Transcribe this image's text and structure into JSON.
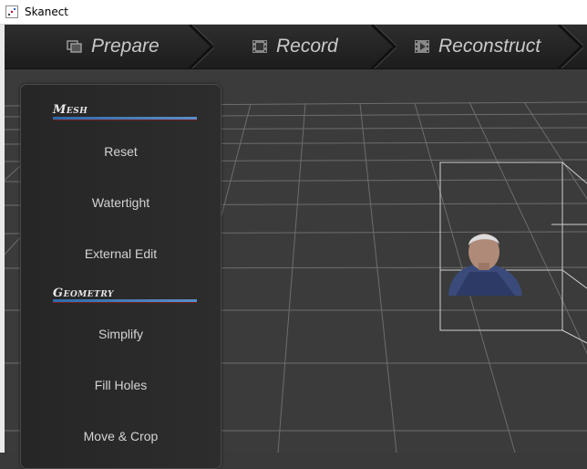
{
  "window": {
    "title": "Skanect"
  },
  "tabs": [
    {
      "label": "Prepare",
      "icon": "photos-icon"
    },
    {
      "label": "Record",
      "icon": "film-icon"
    },
    {
      "label": "Reconstruct",
      "icon": "film-play-icon"
    }
  ],
  "panel": {
    "sections": [
      {
        "title": "Mesh",
        "buttons": [
          "Reset",
          "Watertight",
          "External Edit"
        ]
      },
      {
        "title": "Geometry",
        "buttons": [
          "Simplify",
          "Fill Holes",
          "Move & Crop"
        ]
      }
    ]
  },
  "colors": {
    "accent_blue": "#3a78bc",
    "background": "#3b3b3b",
    "panel": "#2a2a2a",
    "text": "#d4d4d4"
  }
}
